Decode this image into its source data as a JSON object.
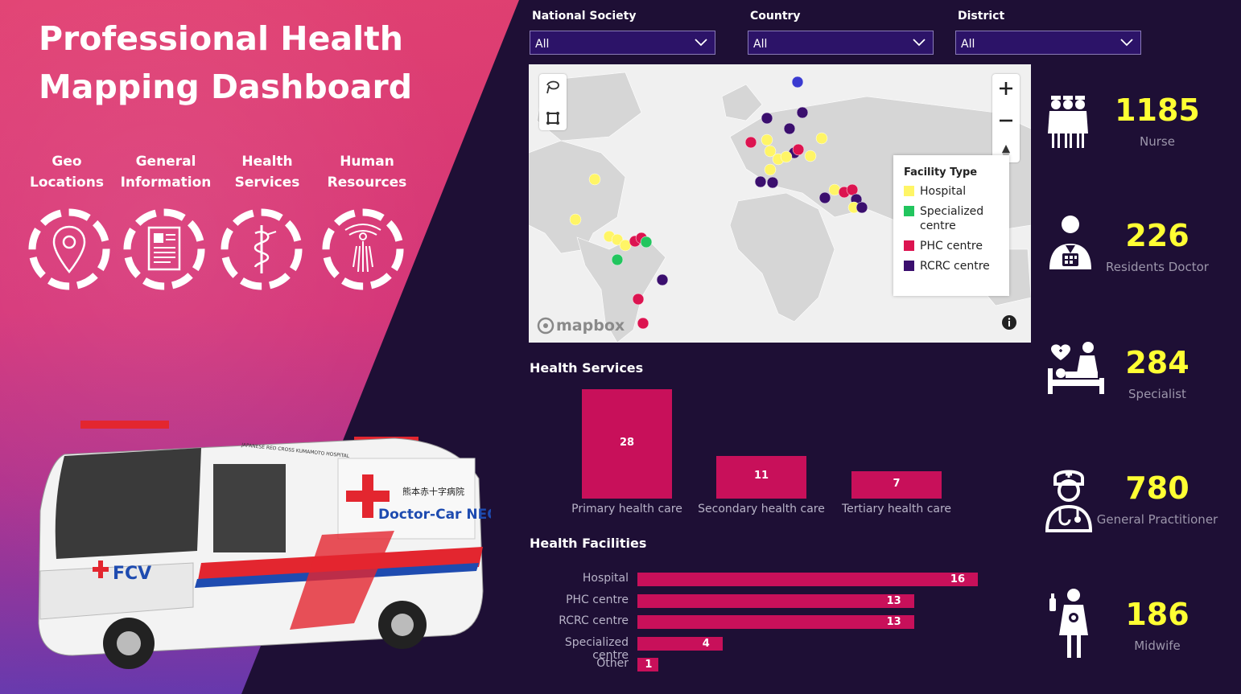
{
  "header": {
    "title_line1": "Professional Health",
    "title_line2": "Mapping Dashboard"
  },
  "nav": [
    {
      "line1": "Geo",
      "line2": "Locations",
      "icon": "map-pin-icon"
    },
    {
      "line1": "General",
      "line2": "Information",
      "icon": "document-icon"
    },
    {
      "line1": "Health",
      "line2": "Services",
      "icon": "caduceus-icon"
    },
    {
      "line1": "Human",
      "line2": "Resources",
      "icon": "person-icon"
    }
  ],
  "van": {
    "top_text": "JAPANESE RED CROSS KUMAMOTO HOSPITAL",
    "side_text": "Doctor-Car NEO",
    "kanji": "熊本赤十字病院",
    "logo": "FCV"
  },
  "filters": [
    {
      "label": "National Society",
      "value": "All"
    },
    {
      "label": "Country",
      "value": "All"
    },
    {
      "label": "District",
      "value": "All"
    }
  ],
  "map": {
    "attribution": "mapbox",
    "legend": {
      "title": "Facility Type",
      "items": [
        {
          "label": "Hospital",
          "color": "#fff566"
        },
        {
          "label": "Specialized centre",
          "color": "#22c55e"
        },
        {
          "label": "PHC centre",
          "color": "#dc1450"
        },
        {
          "label": "RCRC centre",
          "color": "#3b0f6e"
        }
      ]
    }
  },
  "health_services": {
    "title": "Health Services",
    "chart_data": {
      "type": "bar",
      "categories": [
        "Primary health care",
        "Secondary health care",
        "Tertiary health care"
      ],
      "values": [
        28,
        11,
        7
      ]
    }
  },
  "health_facilities": {
    "title": "Health Facilities",
    "chart_data": {
      "type": "bar",
      "categories": [
        "Hospital",
        "PHC centre",
        "RCRC centre",
        "Specialized centre",
        "Other"
      ],
      "values": [
        16,
        13,
        13,
        4,
        1
      ]
    }
  },
  "kpis": [
    {
      "value": "1185",
      "label": "Nurse",
      "icon": "nurses-icon"
    },
    {
      "value": "226",
      "label": "Residents Doctor",
      "icon": "resident-doctor-icon"
    },
    {
      "value": "284",
      "label": "Specialist",
      "icon": "patient-care-icon"
    },
    {
      "value": "780",
      "label": "General Practitioner",
      "icon": "general-practitioner-icon"
    },
    {
      "value": "186",
      "label": "Midwife",
      "icon": "midwife-icon"
    }
  ],
  "colors": {
    "accent": "#c8105a",
    "kpi": "#ffff33",
    "background": "#1e0f35"
  }
}
